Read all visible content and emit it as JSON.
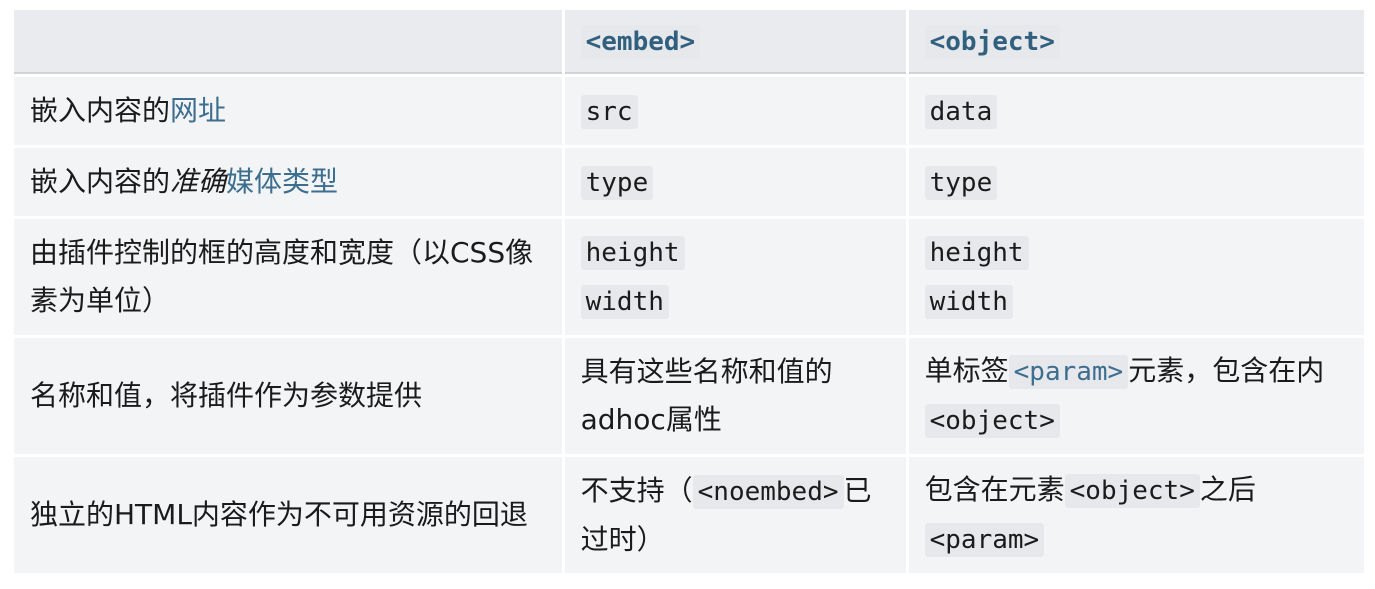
{
  "header": {
    "col1": "",
    "col2": "<embed>",
    "col3": "<object>"
  },
  "rows": [
    {
      "label_prefix": "嵌入内容的",
      "label_link": "网址",
      "embed": "src",
      "object": "data"
    },
    {
      "label_prefix": "嵌入内容的",
      "label_em": "准确",
      "label_link": "媒体类型",
      "embed": "type",
      "object": "type"
    },
    {
      "label": "由插件控制的框的高度和宽度（以CSS像素为单位）",
      "embed": [
        "height",
        "width"
      ],
      "object": [
        "height",
        "width"
      ]
    },
    {
      "label": "名称和值，将插件作为参数提供",
      "embed_text": "具有这些名称和值的adhoc属性",
      "object_prefix": "单标签",
      "object_code": "<param>",
      "object_mid": "元素，包含在内",
      "object_code2": "<object>"
    },
    {
      "label": "独立的HTML内容作为不可用资源的回退",
      "embed_prefix": "不支持（",
      "embed_code": "<noembed>",
      "embed_suffix": "已过时）",
      "object_prefix": "包含在元素",
      "object_code": "<object>",
      "object_mid": "之后",
      "object_code2": "<param>"
    }
  ]
}
